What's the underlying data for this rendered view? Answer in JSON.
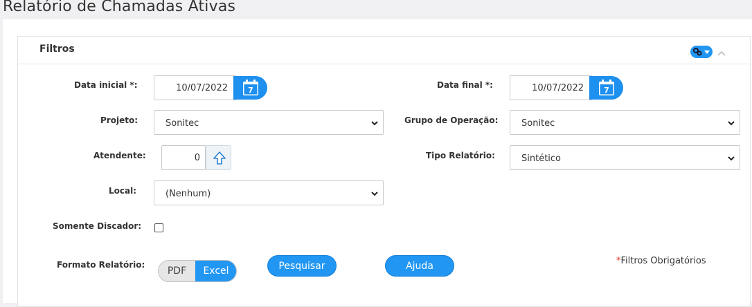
{
  "page": {
    "title": "Relatório de Chamadas Ativas"
  },
  "panel": {
    "title": "Filtros",
    "icons": {
      "settings": "gears-icon",
      "collapse": "chevron-up-icon"
    }
  },
  "filters": {
    "data_inicial": {
      "label": "Data inicial *:",
      "value": "10/07/2022",
      "calendar_day": "7"
    },
    "data_final": {
      "label": "Data final *:",
      "value": "10/07/2022",
      "calendar_day": "7"
    },
    "projeto": {
      "label": "Projeto:",
      "value": "Sonitec"
    },
    "grupo_operacao": {
      "label": "Grupo de Operação:",
      "value": "Sonitec"
    },
    "atendente": {
      "label": "Atendente:",
      "value": "0"
    },
    "tipo_relatorio": {
      "label": "Tipo Relatório:",
      "value": "Sintético"
    },
    "local": {
      "label": "Local:",
      "value": "(Nenhum)"
    },
    "somente_discador": {
      "label": "Somente Discador:",
      "checked": false
    },
    "formato_relatorio": {
      "label": "Formato Relatório:",
      "options": [
        "PDF",
        "Excel"
      ],
      "selected": "Excel"
    }
  },
  "actions": {
    "pesquisar": "Pesquisar",
    "ajuda": "Ajuda"
  },
  "required_note": {
    "star": "*",
    "text": "Filtros Obrigatórios"
  },
  "colors": {
    "accent": "#2196f3",
    "required_star": "#e53935"
  }
}
